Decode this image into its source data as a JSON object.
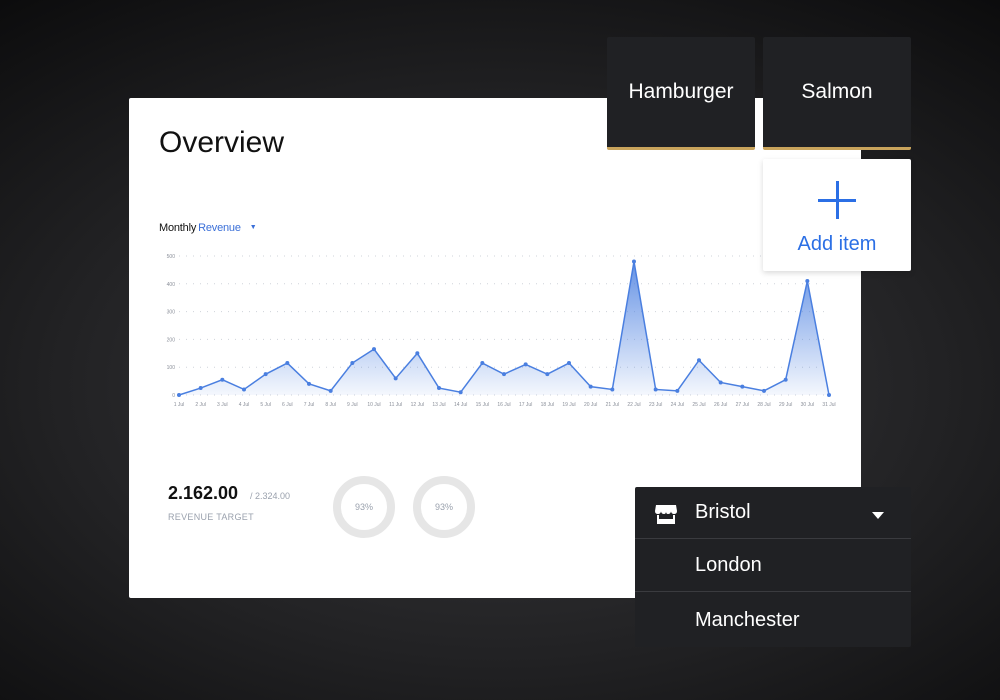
{
  "overview": {
    "title": "Overview",
    "chart_metric_label": "Monthly",
    "chart_metric_value": "Revenue"
  },
  "chart_data": {
    "type": "area",
    "title": "",
    "xlabel": "",
    "ylabel": "",
    "x": [
      "1 Jul",
      "2 Jul",
      "3 Jul",
      "4 Jul",
      "5 Jul",
      "6 Jul",
      "7 Jul",
      "8 Jul",
      "9 Jul",
      "10 Jul",
      "11 Jul",
      "12 Jul",
      "13 Jul",
      "14 Jul",
      "15 Jul",
      "16 Jul",
      "17 Jul",
      "18 Jul",
      "19 Jul",
      "20 Jul",
      "21 Jul",
      "22 Jul",
      "23 Jul",
      "24 Jul",
      "25 Jul",
      "26 Jul",
      "27 Jul",
      "28 Jul",
      "29 Jul",
      "30 Jul",
      "31 Jul"
    ],
    "series": [
      {
        "values": [
          0,
          25,
          55,
          20,
          75,
          115,
          40,
          15,
          115,
          165,
          60,
          150,
          25,
          10,
          115,
          75,
          110,
          75,
          115,
          30,
          20,
          480,
          20,
          15,
          125,
          45,
          30,
          15,
          55,
          410,
          0
        ]
      }
    ],
    "yticks": [
      0,
      100,
      200,
      300,
      400,
      500
    ],
    "ylim": [
      0,
      500
    ],
    "grid": true,
    "color": "#4a7fe0"
  },
  "stats": {
    "revenue_value": "2.162.00",
    "revenue_total": "/ 2.324.00",
    "revenue_label": "REVENUE TARGET",
    "ring1_label": "93%",
    "ring2_label": "93%"
  },
  "tiles": {
    "hamburger": "Hamburger",
    "salmon": "Salmon"
  },
  "add_item": {
    "label": "Add item"
  },
  "location_dropdown": {
    "selected": "Bristol",
    "options": [
      "London",
      "Manchester"
    ]
  },
  "colors": {
    "accent_blue": "#2b6fe5",
    "tile_bg": "#202124",
    "tile_underline": "#c9a45c"
  }
}
